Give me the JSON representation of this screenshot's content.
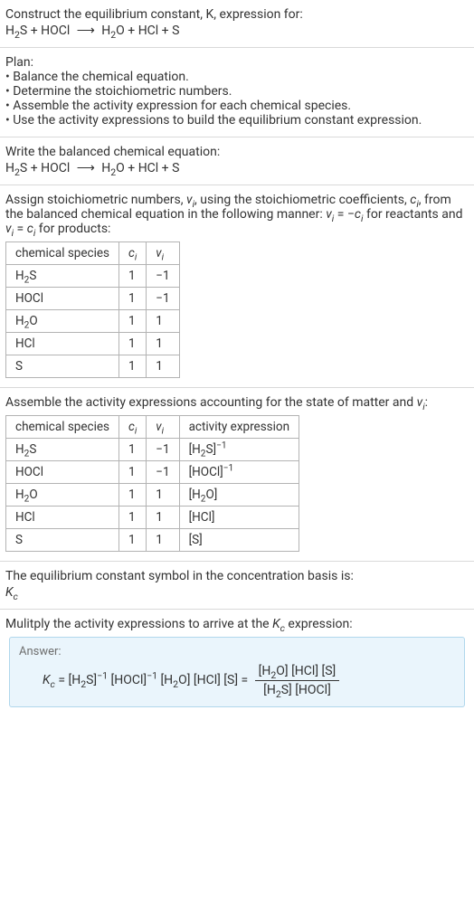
{
  "header": {
    "line1": "Construct the equilibrium constant, K, expression for:",
    "line2_html": "H<sub>2</sub>S + HOCl <span class='arrow'>⟶</span> H<sub>2</sub>O + HCl + S"
  },
  "plan": {
    "title": "Plan:",
    "items": [
      "• Balance the chemical equation.",
      "• Determine the stoichiometric numbers.",
      "• Assemble the activity expression for each chemical species.",
      "• Use the activity expressions to build the equilibrium constant expression."
    ]
  },
  "balanced": {
    "title": "Write the balanced chemical equation:",
    "eq_html": "H<sub>2</sub>S + HOCl <span class='arrow'>⟶</span> H<sub>2</sub>O + HCl + S"
  },
  "stoich": {
    "intro_html": "Assign stoichiometric numbers, <i>ν<sub>i</sub></i>, using the stoichiometric coefficients, <i>c<sub>i</sub></i>, from the balanced chemical equation in the following manner: <i>ν<sub>i</sub></i> = −<i>c<sub>i</sub></i> for reactants and <i>ν<sub>i</sub></i> = <i>c<sub>i</sub></i> for products:",
    "headers": [
      "chemical species",
      "c_i",
      "ν_i"
    ],
    "headers_html": [
      "chemical species",
      "<i>c<sub>i</sub></i>",
      "<i>ν<sub>i</sub></i>"
    ],
    "rows": [
      {
        "species_html": "H<sub>2</sub>S",
        "c": "1",
        "nu": "−1"
      },
      {
        "species_html": "HOCl",
        "c": "1",
        "nu": "−1"
      },
      {
        "species_html": "H<sub>2</sub>O",
        "c": "1",
        "nu": "1"
      },
      {
        "species_html": "HCl",
        "c": "1",
        "nu": "1"
      },
      {
        "species_html": "S",
        "c": "1",
        "nu": "1"
      }
    ]
  },
  "activity": {
    "intro_html": "Assemble the activity expressions accounting for the state of matter and <i>ν<sub>i</sub></i>:",
    "headers_html": [
      "chemical species",
      "<i>c<sub>i</sub></i>",
      "<i>ν<sub>i</sub></i>",
      "activity expression"
    ],
    "rows": [
      {
        "species_html": "H<sub>2</sub>S",
        "c": "1",
        "nu": "−1",
        "act_html": "[H<sub>2</sub>S]<sup>−1</sup>"
      },
      {
        "species_html": "HOCl",
        "c": "1",
        "nu": "−1",
        "act_html": "[HOCl]<sup>−1</sup>"
      },
      {
        "species_html": "H<sub>2</sub>O",
        "c": "1",
        "nu": "1",
        "act_html": "[H<sub>2</sub>O]"
      },
      {
        "species_html": "HCl",
        "c": "1",
        "nu": "1",
        "act_html": "[HCl]"
      },
      {
        "species_html": "S",
        "c": "1",
        "nu": "1",
        "act_html": "[S]"
      }
    ]
  },
  "kc_symbol": {
    "line1": "The equilibrium constant symbol in the concentration basis is:",
    "line2_html": "<i>K<sub>c</sub></i>"
  },
  "multiply": {
    "title_html": "Mulitply the activity expressions to arrive at the <i>K<sub>c</sub></i> expression:"
  },
  "answer": {
    "label": "Answer:",
    "expr_left_html": "<i>K<sub>c</sub></i> = [H<sub>2</sub>S]<sup>−1</sup> [HOCl]<sup>−1</sup> [H<sub>2</sub>O] [HCl] [S] = ",
    "frac_num_html": "[H<sub>2</sub>O] [HCl] [S]",
    "frac_den_html": "[H<sub>2</sub>S] [HOCl]"
  },
  "chart_data": {
    "type": "table",
    "tables": [
      {
        "title": "stoichiometric numbers",
        "columns": [
          "chemical species",
          "c_i",
          "nu_i"
        ],
        "rows": [
          [
            "H2S",
            1,
            -1
          ],
          [
            "HOCl",
            1,
            -1
          ],
          [
            "H2O",
            1,
            1
          ],
          [
            "HCl",
            1,
            1
          ],
          [
            "S",
            1,
            1
          ]
        ]
      },
      {
        "title": "activity expressions",
        "columns": [
          "chemical species",
          "c_i",
          "nu_i",
          "activity expression"
        ],
        "rows": [
          [
            "H2S",
            1,
            -1,
            "[H2S]^-1"
          ],
          [
            "HOCl",
            1,
            -1,
            "[HOCl]^-1"
          ],
          [
            "H2O",
            1,
            1,
            "[H2O]"
          ],
          [
            "HCl",
            1,
            1,
            "[HCl]"
          ],
          [
            "S",
            1,
            1,
            "[S]"
          ]
        ]
      }
    ]
  }
}
